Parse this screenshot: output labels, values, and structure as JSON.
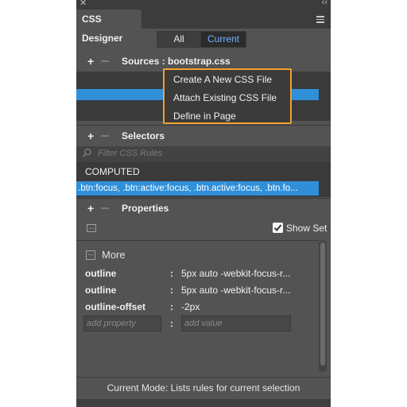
{
  "panel": {
    "title": "CSS Designer"
  },
  "view_toggle": {
    "all": "All",
    "current": "Current"
  },
  "sources": {
    "header": "Sources : bootstrap.css"
  },
  "add_menu": {
    "items": [
      "Create A New CSS File",
      "Attach Existing CSS File",
      "Define in Page"
    ]
  },
  "selectors": {
    "header": "Selectors",
    "filter_placeholder": "Filter CSS Rules",
    "computed": "COMPUTED",
    "selected": ".btn:focus, .btn:active:focus, .btn.active:focus, .btn.fo..."
  },
  "properties": {
    "header": "Properties",
    "show_set": "Show Set",
    "show_set_checked": true,
    "more": "More",
    "rows": [
      {
        "name": "outline",
        "value": "5px auto -webkit-focus-r..."
      },
      {
        "name": "outline",
        "value": "5px auto -webkit-focus-r..."
      },
      {
        "name": "outline-offset",
        "value": "-2px"
      }
    ],
    "add_property_placeholder": "add property",
    "add_value_placeholder": "add value"
  },
  "status": "Current Mode: Lists rules for current selection",
  "colors": {
    "accent_blue": "#2f8fd9",
    "highlight_orange": "#f0a030",
    "panel_bg": "#535353"
  }
}
